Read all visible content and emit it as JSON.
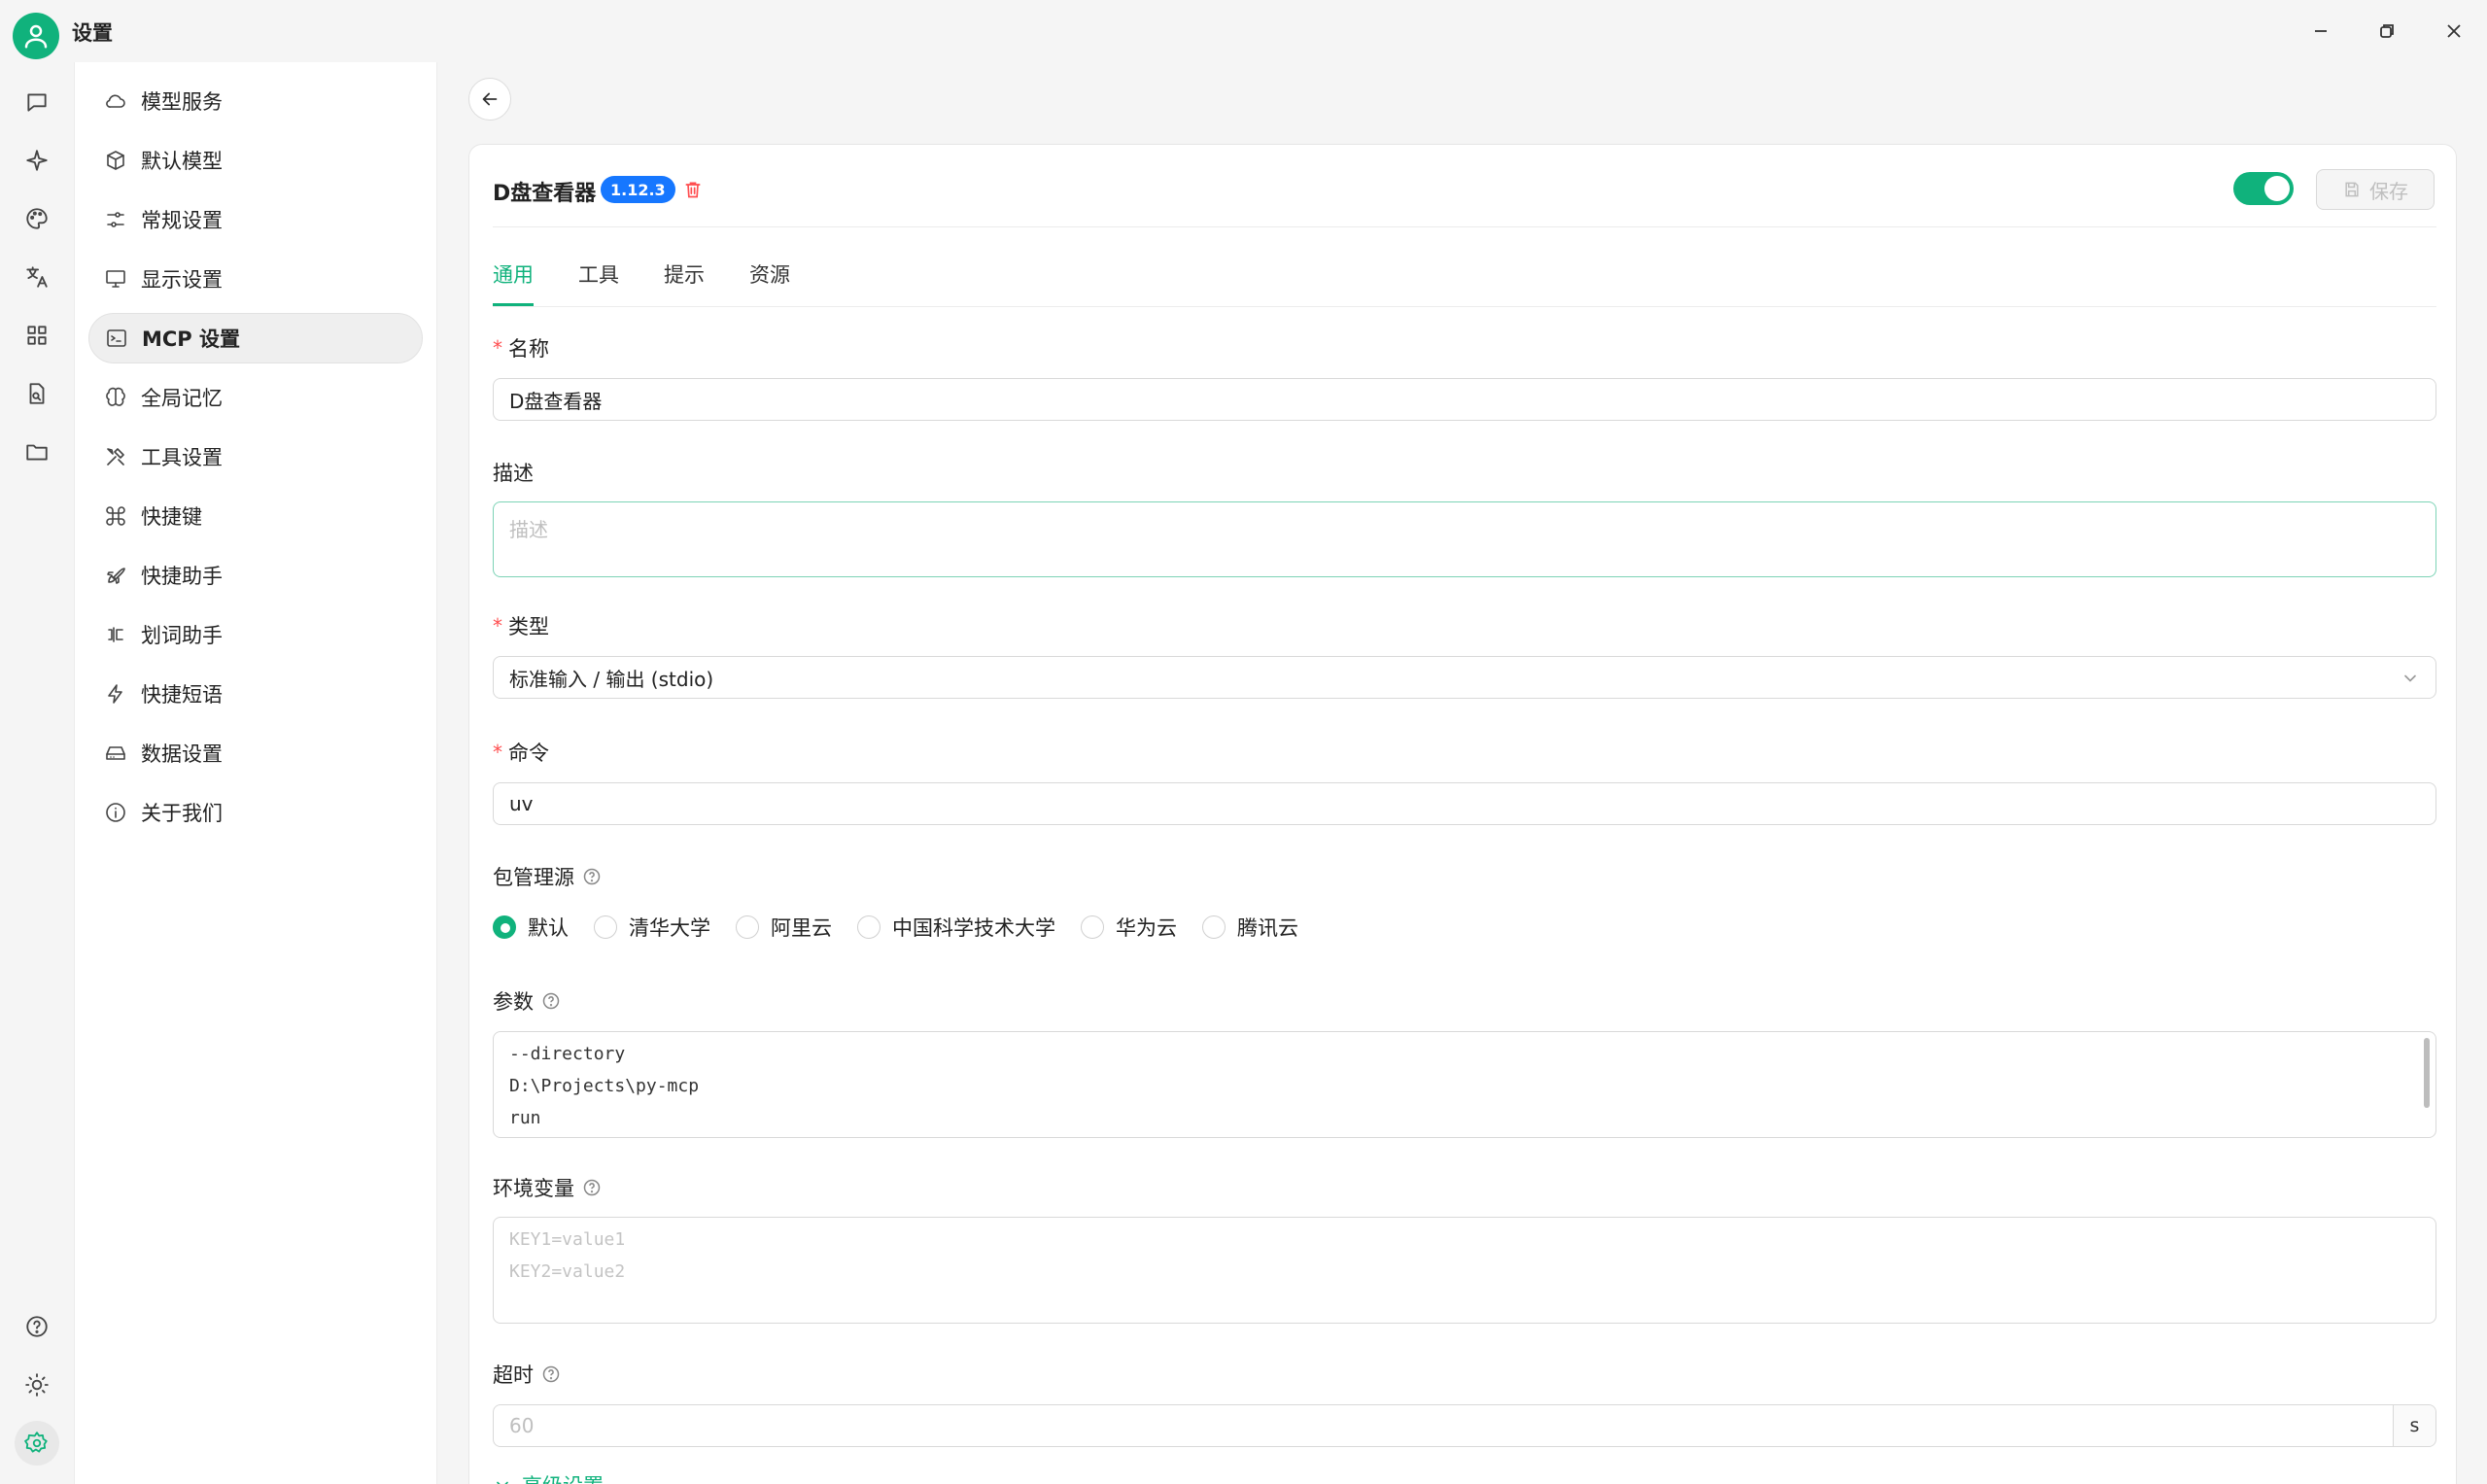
{
  "app": {
    "title": "设置"
  },
  "menu": {
    "items": [
      {
        "label": "模型服务",
        "icon": "cloud-icon"
      },
      {
        "label": "默认模型",
        "icon": "cube-icon"
      },
      {
        "label": "常规设置",
        "icon": "sliders-icon"
      },
      {
        "label": "显示设置",
        "icon": "monitor-icon"
      },
      {
        "label": "MCP 设置",
        "icon": "terminal-icon",
        "active": true
      },
      {
        "label": "全局记忆",
        "icon": "brain-icon"
      },
      {
        "label": "工具设置",
        "icon": "tools-icon"
      },
      {
        "label": "快捷键",
        "icon": "command-icon"
      },
      {
        "label": "快捷助手",
        "icon": "rocket-icon"
      },
      {
        "label": "划词助手",
        "icon": "text-select-icon"
      },
      {
        "label": "快捷短语",
        "icon": "zap-icon"
      },
      {
        "label": "数据设置",
        "icon": "hard-drive-icon"
      },
      {
        "label": "关于我们",
        "icon": "info-icon"
      }
    ]
  },
  "server": {
    "name": "D盘查看器",
    "version": "1.12.3",
    "enabled": true,
    "save_label": "保存"
  },
  "tabs": [
    "通用",
    "工具",
    "提示",
    "资源"
  ],
  "form": {
    "name_label": "名称",
    "name_value": "D盘查看器",
    "desc_label": "描述",
    "desc_placeholder": "描述",
    "type_label": "类型",
    "type_value": "标准输入 / 输出 (stdio)",
    "command_label": "命令",
    "command_value": "uv",
    "registry_label": "包管理源",
    "registry_options": [
      "默认",
      "清华大学",
      "阿里云",
      "中国科学技术大学",
      "华为云",
      "腾讯云"
    ],
    "registry_selected": "默认",
    "args_label": "参数",
    "args_lines": [
      "--directory",
      "D:\\Projects\\py-mcp",
      "run"
    ],
    "env_label": "环境变量",
    "env_placeholder_lines": [
      "KEY1=value1",
      "KEY2=value2"
    ],
    "timeout_label": "超时",
    "timeout_placeholder": "60",
    "timeout_unit": "s",
    "advanced_label": "高级设置"
  },
  "colors": {
    "accent": "#10b27c",
    "badge": "#1677ff",
    "danger": "#ff4d4f"
  }
}
